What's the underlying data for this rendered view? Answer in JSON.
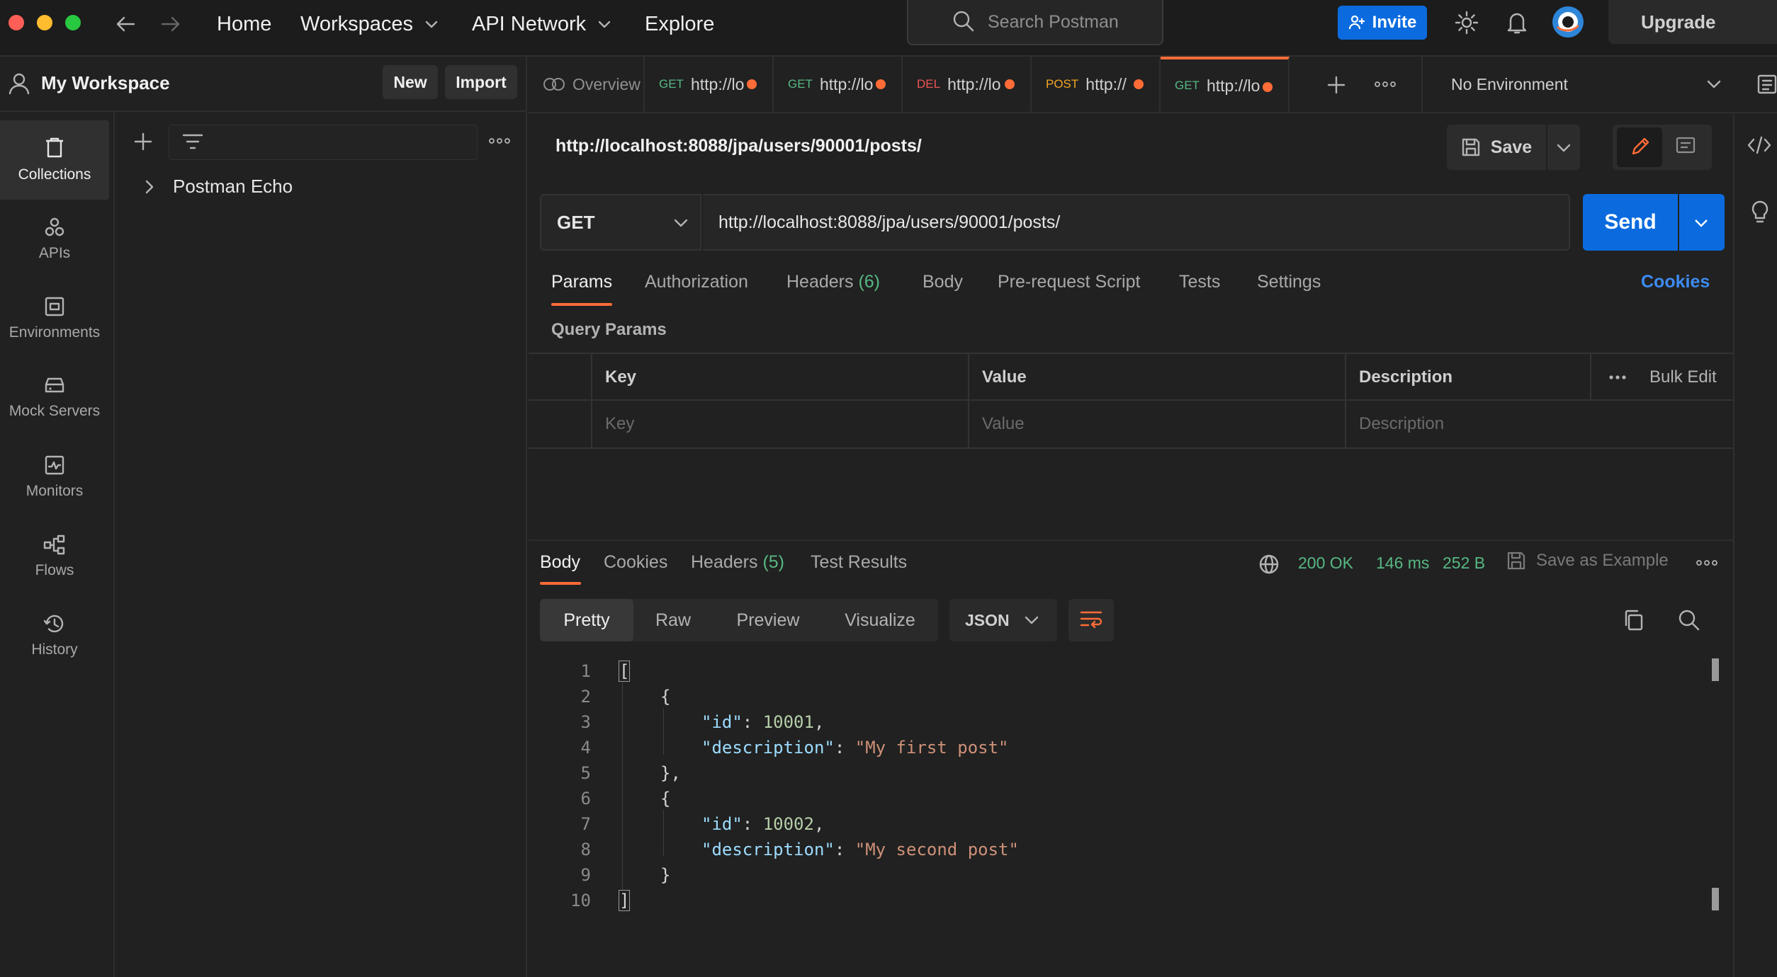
{
  "topbar": {
    "nav": {
      "home": "Home",
      "workspaces": "Workspaces",
      "api_network": "API Network",
      "explore": "Explore"
    },
    "search_placeholder": "Search Postman",
    "invite_label": "Invite",
    "upgrade_label": "Upgrade"
  },
  "workspace": {
    "name": "My Workspace",
    "new_label": "New",
    "import_label": "Import"
  },
  "sidebar": {
    "items": [
      {
        "label": "Collections",
        "icon": "trash-can-icon"
      },
      {
        "label": "APIs",
        "icon": "apis-icon"
      },
      {
        "label": "Environments",
        "icon": "environments-icon"
      },
      {
        "label": "Mock Servers",
        "icon": "server-icon"
      },
      {
        "label": "Monitors",
        "icon": "monitor-icon"
      },
      {
        "label": "Flows",
        "icon": "flows-icon"
      },
      {
        "label": "History",
        "icon": "history-icon"
      }
    ]
  },
  "collections": {
    "items": [
      {
        "name": "Postman Echo"
      }
    ]
  },
  "tabs": {
    "overview": "Overview",
    "items": [
      {
        "method": "GET",
        "url": "http://localhost",
        "color": "#57b883"
      },
      {
        "method": "GET",
        "url": "http://localhost",
        "color": "#57b883"
      },
      {
        "method": "DEL",
        "url": "http://localhost",
        "color": "#f05454"
      },
      {
        "method": "POST",
        "url": "http://",
        "color": "#f5a623"
      },
      {
        "method": "GET",
        "url": "http://localhost",
        "color": "#57b883"
      }
    ],
    "environment": "No Environment"
  },
  "request": {
    "title": "http://localhost:8088/jpa/users/90001/posts/",
    "save_label": "Save",
    "method": "GET",
    "url": "http://localhost:8088/jpa/users/90001/posts/",
    "send_label": "Send",
    "tabs": {
      "params": "Params",
      "authorization": "Authorization",
      "headers": "Headers",
      "headers_count": "(6)",
      "body": "Body",
      "prerequest": "Pre-request Script",
      "tests": "Tests",
      "settings": "Settings"
    },
    "cookies_label": "Cookies",
    "query_params_title": "Query Params",
    "params_table": {
      "columns": [
        "Key",
        "Value",
        "Description"
      ],
      "bulk_edit": "Bulk Edit",
      "placeholders": {
        "key": "Key",
        "value": "Value",
        "description": "Description"
      }
    }
  },
  "response": {
    "tabs": {
      "body": "Body",
      "cookies": "Cookies",
      "headers": "Headers",
      "headers_count": "(5)",
      "test_results": "Test Results"
    },
    "status": "200 OK",
    "time": "146 ms",
    "size": "252 B",
    "save_example_label": "Save as Example",
    "view_modes": [
      "Pretty",
      "Raw",
      "Preview",
      "Visualize"
    ],
    "format": "JSON",
    "line_numbers": [
      "1",
      "2",
      "3",
      "4",
      "5",
      "6",
      "7",
      "8",
      "9",
      "10"
    ],
    "body": [
      {
        "id": 10001,
        "description": "My first post"
      },
      {
        "id": 10002,
        "description": "My second post"
      }
    ],
    "code": {
      "open_bracket": "[",
      "close_bracket": "]",
      "open_brace": "{",
      "close_brace_comma": "},",
      "close_brace": "}",
      "id_key": "\"id\"",
      "desc_key": "\"description\"",
      "id_1": "10001",
      "desc_1": "\"My first post\"",
      "id_2": "10002",
      "desc_2": "\"My second post\""
    }
  }
}
